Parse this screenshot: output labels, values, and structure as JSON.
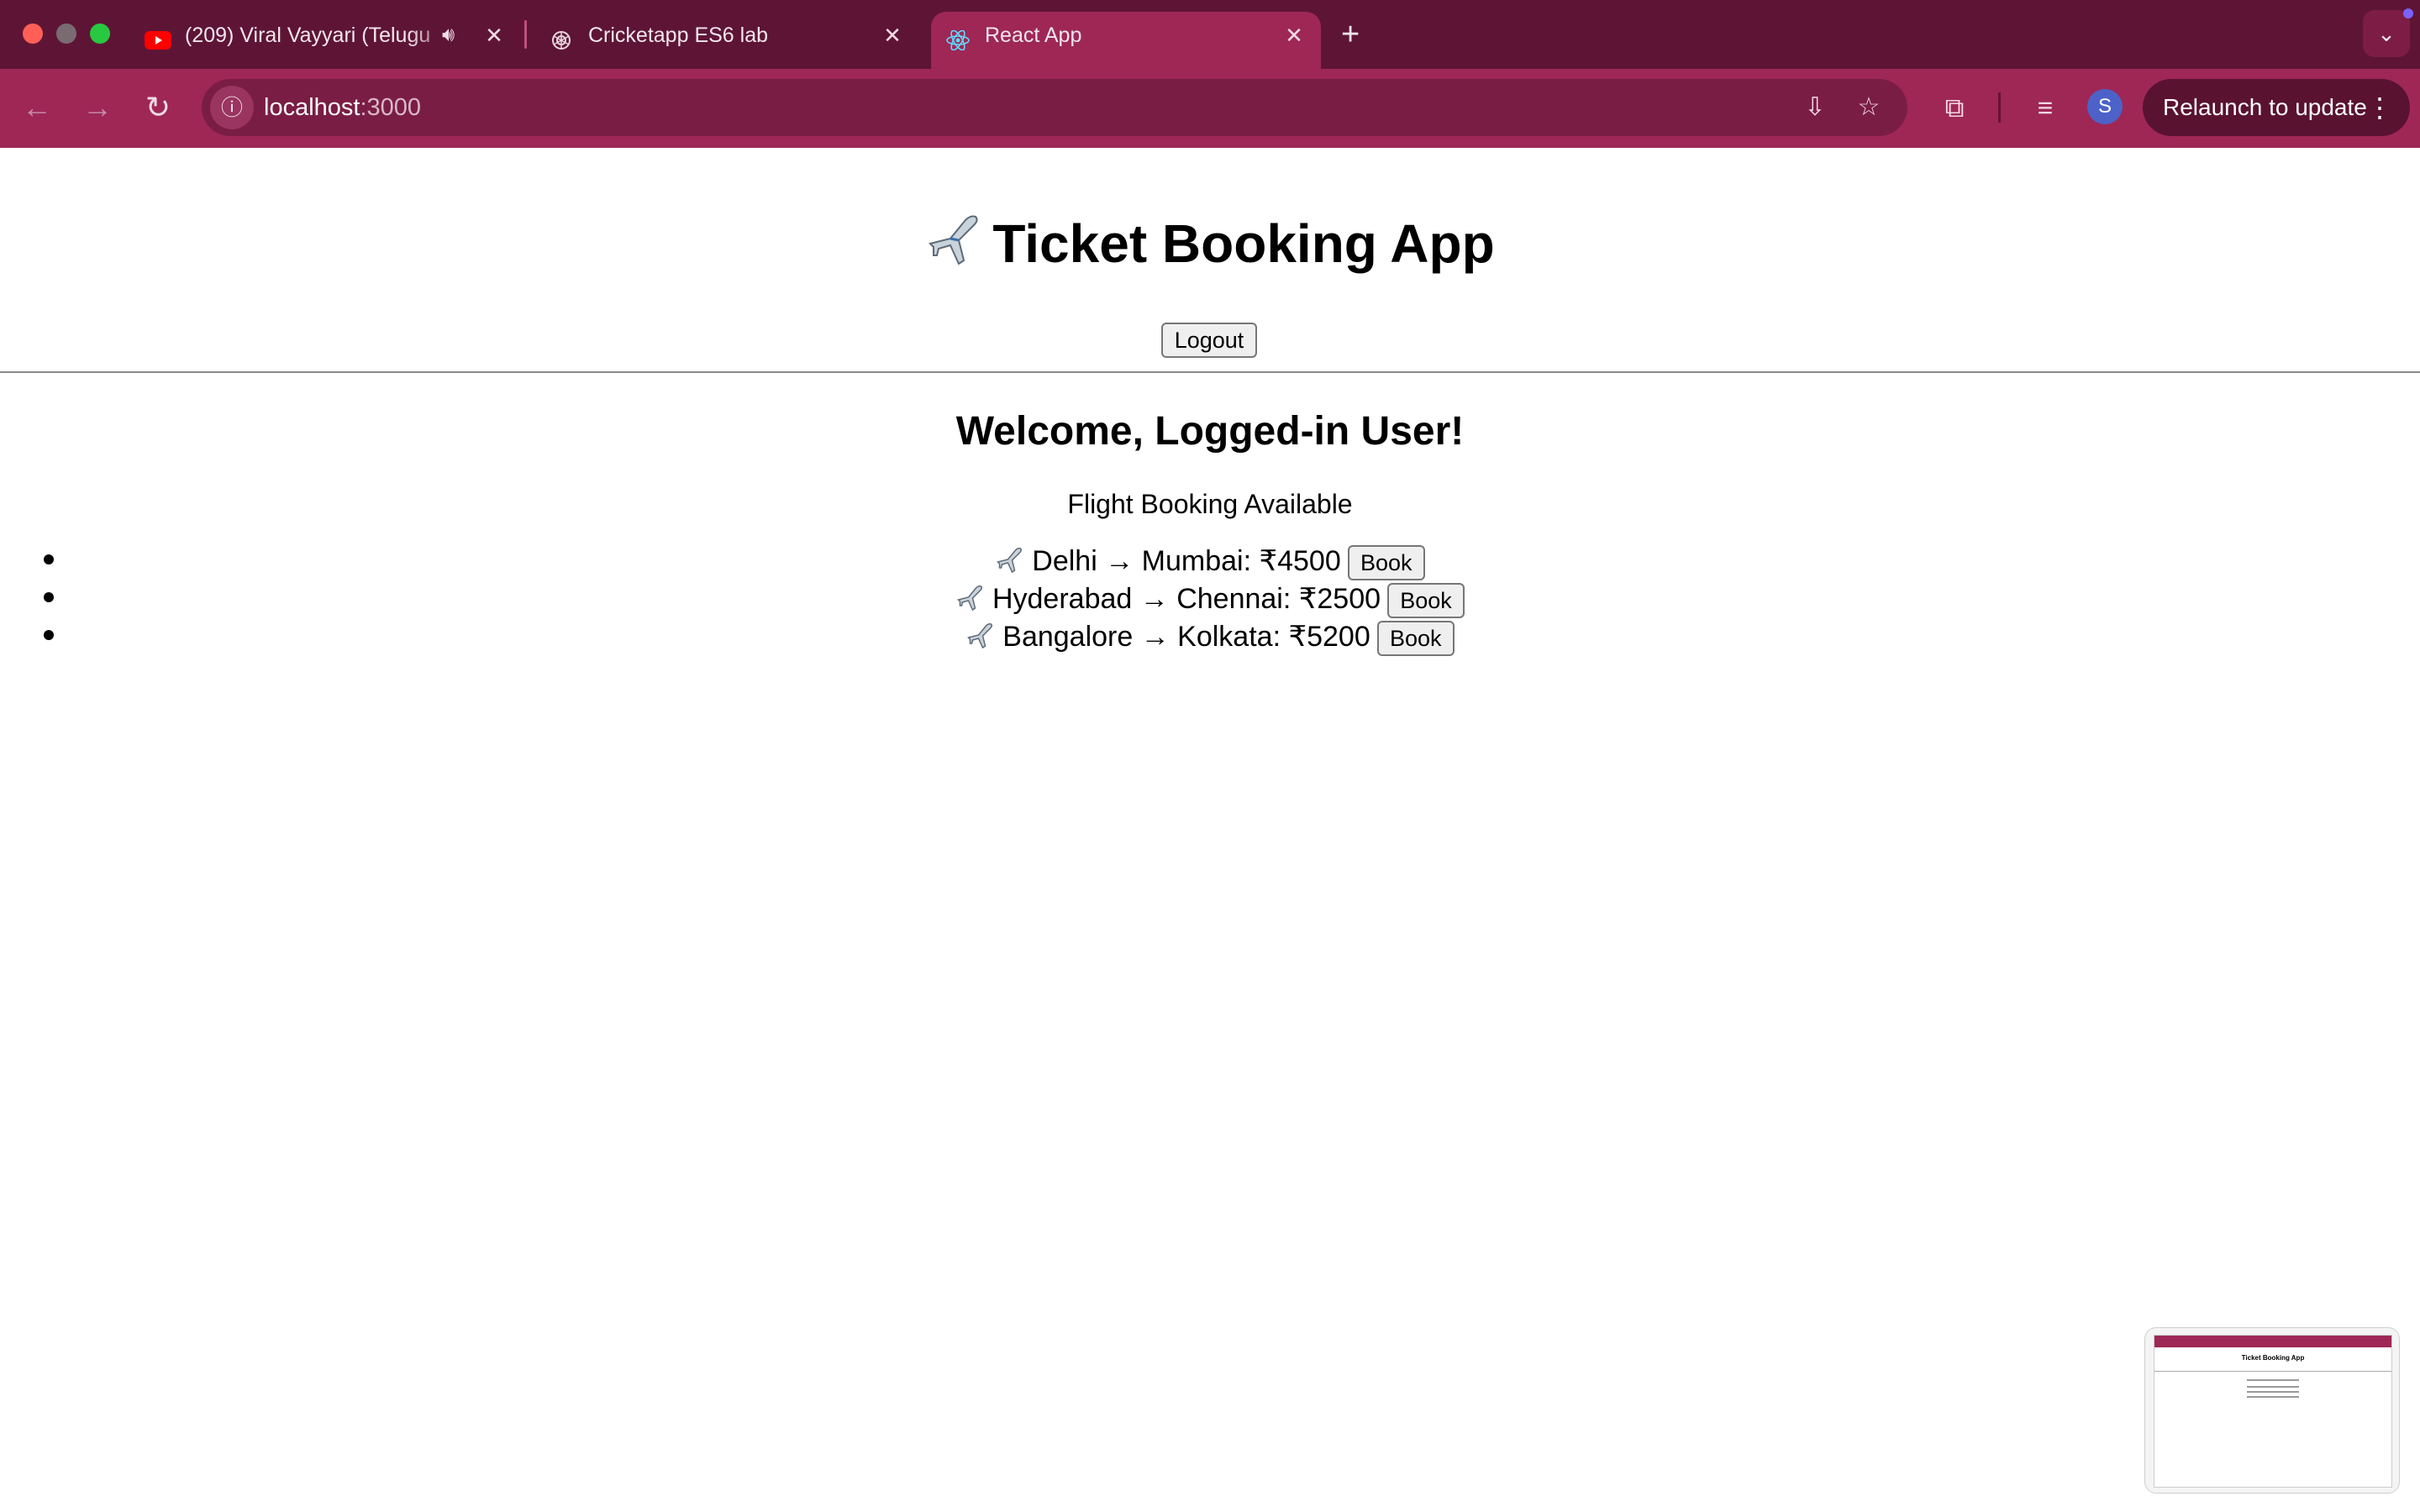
{
  "browser": {
    "tabs": [
      {
        "title": "(209) Viral Vayyari (Telugu",
        "icon": "youtube-icon",
        "audio": "speaker-icon",
        "active": false
      },
      {
        "title": "Cricketapp ES6 lab",
        "icon": "chatgpt-icon",
        "active": false
      },
      {
        "title": "React App",
        "icon": "react-icon",
        "active": true
      }
    ],
    "url_host": "localhost",
    "url_port": ":3000",
    "relaunch_label": "Relaunch to update",
    "avatar_initial": "S",
    "colors": {
      "tabbar": "#5e1535",
      "toolbar": "#9e2756",
      "omnibox": "#7a1d44"
    }
  },
  "app": {
    "title": "Ticket Booking App",
    "title_icon": "airplane-icon",
    "logout_label": "Logout",
    "welcome": "Welcome, Logged-in User!",
    "subtitle": "Flight Booking Available",
    "book_label": "Book",
    "flights": [
      {
        "text": "Delhi → Mumbai: ₹4500"
      },
      {
        "text": "Hyderabad → Chennai: ₹2500"
      },
      {
        "text": "Bangalore → Kolkata: ₹5200"
      }
    ]
  },
  "thumbnail": {
    "title": "Ticket Booking App"
  }
}
